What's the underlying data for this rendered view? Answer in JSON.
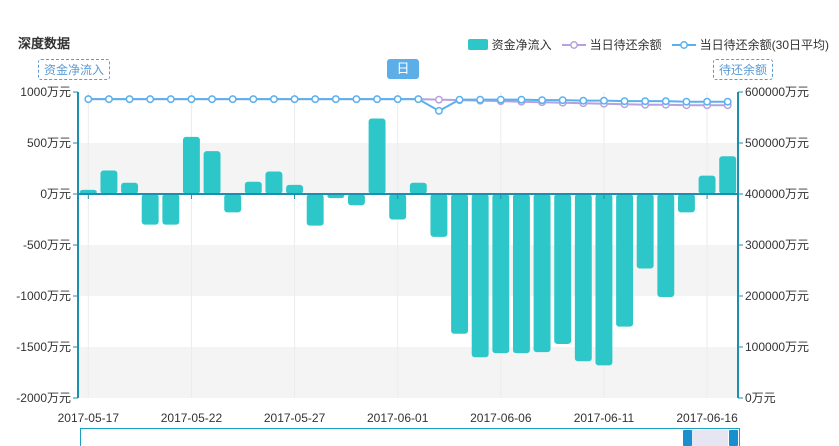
{
  "title": "深度数据",
  "legend": [
    {
      "label": "资金净流入",
      "color": "#2ec7c9",
      "kind": "bar"
    },
    {
      "label": "当日待还余额",
      "color": "#b6a2de",
      "kind": "line"
    },
    {
      "label": "当日待还余额(30日平均)",
      "color": "#5ab1ef",
      "kind": "line"
    }
  ],
  "left_axis_name": "资金净流入",
  "right_axis_name": "待还余额",
  "period_button": "日",
  "chart_data": {
    "type": "bar",
    "title": "深度数据",
    "x": [
      "2017-05-17",
      "2017-05-18",
      "2017-05-19",
      "2017-05-20",
      "2017-05-21",
      "2017-05-22",
      "2017-05-23",
      "2017-05-24",
      "2017-05-25",
      "2017-05-26",
      "2017-05-27",
      "2017-05-28",
      "2017-05-29",
      "2017-05-30",
      "2017-05-31",
      "2017-06-01",
      "2017-06-02",
      "2017-06-03",
      "2017-06-04",
      "2017-06-05",
      "2017-06-06",
      "2017-06-07",
      "2017-06-08",
      "2017-06-09",
      "2017-06-10",
      "2017-06-11",
      "2017-06-12",
      "2017-06-13",
      "2017-06-14",
      "2017-06-15",
      "2017-06-16",
      "2017-06-17"
    ],
    "x_tick_labels": [
      "2017-05-17",
      "2017-05-22",
      "2017-05-27",
      "2017-06-01",
      "2017-06-06",
      "2017-06-11",
      "2017-06-16"
    ],
    "series": [
      {
        "name": "资金净流入",
        "type": "bar",
        "axis": "left",
        "color": "#2ec7c9",
        "values": [
          40,
          230,
          110,
          -300,
          -300,
          560,
          420,
          -180,
          120,
          220,
          90,
          -310,
          -40,
          -110,
          740,
          -250,
          110,
          -420,
          -1370,
          -1600,
          -1560,
          -1560,
          -1550,
          -1470,
          -1640,
          -1680,
          -1300,
          -730,
          -1010,
          -180,
          180,
          370
        ]
      },
      {
        "name": "当日待还余额",
        "type": "line",
        "axis": "right",
        "color": "#b6a2de",
        "values": [
          586000,
          586000,
          586000,
          586000,
          586000,
          586000,
          586000,
          586000,
          586000,
          586000,
          586000,
          586000,
          586000,
          586000,
          586000,
          586000,
          586000,
          585000,
          584000,
          583000,
          582000,
          581000,
          580000,
          579000,
          578000,
          577000,
          576000,
          575000,
          575000,
          574000,
          574000,
          574000
        ]
      },
      {
        "name": "当日待还余额(30日平均)",
        "type": "line",
        "axis": "right",
        "color": "#5ab1ef",
        "values": [
          586000,
          586000,
          586000,
          586000,
          586000,
          586000,
          586000,
          586000,
          586000,
          586000,
          586000,
          586000,
          586000,
          586000,
          586000,
          586000,
          586000,
          563000,
          585000,
          585000,
          585000,
          585000,
          584000,
          584000,
          583000,
          583000,
          582000,
          582000,
          582000,
          581000,
          581000,
          581000
        ]
      }
    ],
    "left_axis": {
      "min": -2000,
      "max": 1000,
      "ticks": [
        "1000万元",
        "500万元",
        "0万元",
        "-500万元",
        "-1000万元",
        "-1500万元",
        "-2000万元"
      ]
    },
    "right_axis": {
      "min": 0,
      "max": 600000,
      "ticks": [
        "600000万元",
        "500000万元",
        "400000万元",
        "300000万元",
        "200000万元",
        "100000万元",
        "0万元"
      ]
    },
    "grid": true,
    "legend_position": "top-right"
  }
}
